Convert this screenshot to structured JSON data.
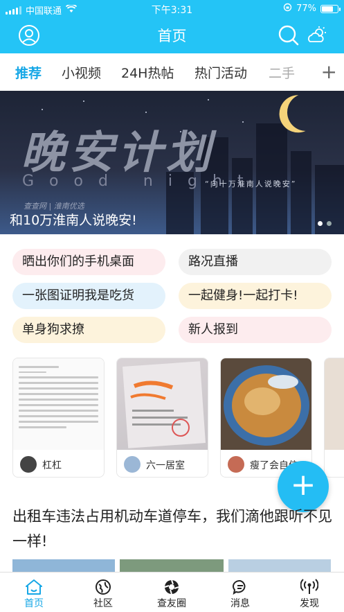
{
  "status_bar": {
    "carrier": "中国联通",
    "time": "下午3:31",
    "battery": "77%",
    "battery_level": 0.77
  },
  "header": {
    "title": "首页"
  },
  "tabs": [
    "推荐",
    "小视频",
    "24H热帖",
    "热门活动",
    "二手"
  ],
  "tabs_active_index": 0,
  "tab_add_label": "+",
  "banner": {
    "headline_art": "晚安计划",
    "sub_art": "Good night",
    "quote": "“向十万淮南人说晚安”",
    "brand": "查查网 | 淮南优选",
    "caption": "和10万淮南人说晚安!",
    "page_count": 2,
    "page_index": 0
  },
  "topics": [
    {
      "label": "晒出你们的手机桌面",
      "color": "#fdecee"
    },
    {
      "label": "路况直播",
      "color": "#f1f1f1"
    },
    {
      "label": "一张图证明我是吃货",
      "color": "#e3f2fc"
    },
    {
      "label": "一起健身!一起打卡!",
      "color": "#fdf3dc"
    },
    {
      "label": "单身狗求撩",
      "color": "#fdf3dc"
    },
    {
      "label": "新人报到",
      "color": "#fdecee"
    }
  ],
  "posts": [
    {
      "user": "杠杠",
      "thumb": "news-article"
    },
    {
      "user": "六一居室",
      "thumb": "document-photo"
    },
    {
      "user": "瘦了会自信",
      "thumb": "noodle-bowl"
    }
  ],
  "fab_label": "+",
  "feed": {
    "headline": "出租车违法占用机动车道停车，我们滴他跟听不见一样!"
  },
  "bottom_nav": [
    {
      "label": "首页",
      "icon": "home-icon",
      "active": true
    },
    {
      "label": "社区",
      "icon": "community-icon",
      "active": false
    },
    {
      "label": "查友圈",
      "icon": "aperture-icon",
      "active": false
    },
    {
      "label": "消息",
      "icon": "message-icon",
      "active": false
    },
    {
      "label": "发现",
      "icon": "signal-icon",
      "active": false
    }
  ],
  "colors": {
    "accent": "#24c4f6",
    "active_text": "#16a7e6"
  }
}
